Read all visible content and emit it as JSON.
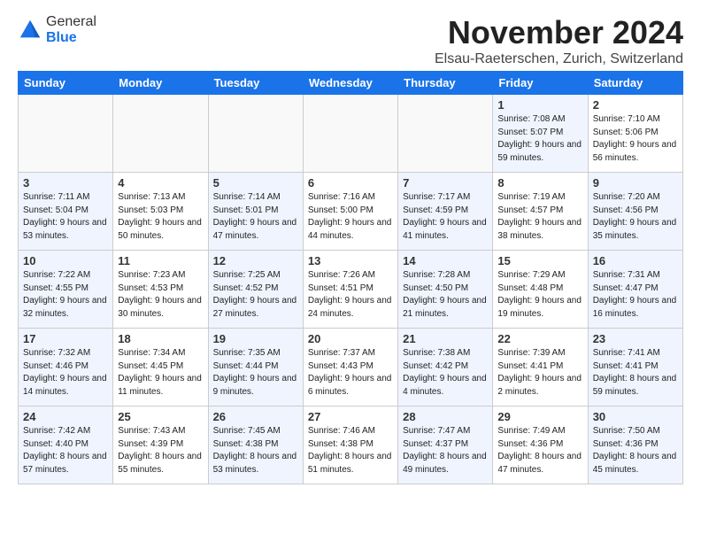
{
  "logo": {
    "general": "General",
    "blue": "Blue"
  },
  "title": "November 2024",
  "subtitle": "Elsau-Raeterschen, Zurich, Switzerland",
  "headers": [
    "Sunday",
    "Monday",
    "Tuesday",
    "Wednesday",
    "Thursday",
    "Friday",
    "Saturday"
  ],
  "weeks": [
    [
      {
        "day": "",
        "info": "",
        "empty": true
      },
      {
        "day": "",
        "info": "",
        "empty": true
      },
      {
        "day": "",
        "info": "",
        "empty": true
      },
      {
        "day": "",
        "info": "",
        "empty": true
      },
      {
        "day": "",
        "info": "",
        "empty": true
      },
      {
        "day": "1",
        "info": "Sunrise: 7:08 AM\nSunset: 5:07 PM\nDaylight: 9 hours and 59 minutes.",
        "shaded": true
      },
      {
        "day": "2",
        "info": "Sunrise: 7:10 AM\nSunset: 5:06 PM\nDaylight: 9 hours and 56 minutes.",
        "shaded": false
      }
    ],
    [
      {
        "day": "3",
        "info": "Sunrise: 7:11 AM\nSunset: 5:04 PM\nDaylight: 9 hours and 53 minutes.",
        "shaded": true
      },
      {
        "day": "4",
        "info": "Sunrise: 7:13 AM\nSunset: 5:03 PM\nDaylight: 9 hours and 50 minutes.",
        "shaded": false
      },
      {
        "day": "5",
        "info": "Sunrise: 7:14 AM\nSunset: 5:01 PM\nDaylight: 9 hours and 47 minutes.",
        "shaded": true
      },
      {
        "day": "6",
        "info": "Sunrise: 7:16 AM\nSunset: 5:00 PM\nDaylight: 9 hours and 44 minutes.",
        "shaded": false
      },
      {
        "day": "7",
        "info": "Sunrise: 7:17 AM\nSunset: 4:59 PM\nDaylight: 9 hours and 41 minutes.",
        "shaded": true
      },
      {
        "day": "8",
        "info": "Sunrise: 7:19 AM\nSunset: 4:57 PM\nDaylight: 9 hours and 38 minutes.",
        "shaded": false
      },
      {
        "day": "9",
        "info": "Sunrise: 7:20 AM\nSunset: 4:56 PM\nDaylight: 9 hours and 35 minutes.",
        "shaded": true
      }
    ],
    [
      {
        "day": "10",
        "info": "Sunrise: 7:22 AM\nSunset: 4:55 PM\nDaylight: 9 hours and 32 minutes.",
        "shaded": true
      },
      {
        "day": "11",
        "info": "Sunrise: 7:23 AM\nSunset: 4:53 PM\nDaylight: 9 hours and 30 minutes.",
        "shaded": false
      },
      {
        "day": "12",
        "info": "Sunrise: 7:25 AM\nSunset: 4:52 PM\nDaylight: 9 hours and 27 minutes.",
        "shaded": true
      },
      {
        "day": "13",
        "info": "Sunrise: 7:26 AM\nSunset: 4:51 PM\nDaylight: 9 hours and 24 minutes.",
        "shaded": false
      },
      {
        "day": "14",
        "info": "Sunrise: 7:28 AM\nSunset: 4:50 PM\nDaylight: 9 hours and 21 minutes.",
        "shaded": true
      },
      {
        "day": "15",
        "info": "Sunrise: 7:29 AM\nSunset: 4:48 PM\nDaylight: 9 hours and 19 minutes.",
        "shaded": false
      },
      {
        "day": "16",
        "info": "Sunrise: 7:31 AM\nSunset: 4:47 PM\nDaylight: 9 hours and 16 minutes.",
        "shaded": true
      }
    ],
    [
      {
        "day": "17",
        "info": "Sunrise: 7:32 AM\nSunset: 4:46 PM\nDaylight: 9 hours and 14 minutes.",
        "shaded": true
      },
      {
        "day": "18",
        "info": "Sunrise: 7:34 AM\nSunset: 4:45 PM\nDaylight: 9 hours and 11 minutes.",
        "shaded": false
      },
      {
        "day": "19",
        "info": "Sunrise: 7:35 AM\nSunset: 4:44 PM\nDaylight: 9 hours and 9 minutes.",
        "shaded": true
      },
      {
        "day": "20",
        "info": "Sunrise: 7:37 AM\nSunset: 4:43 PM\nDaylight: 9 hours and 6 minutes.",
        "shaded": false
      },
      {
        "day": "21",
        "info": "Sunrise: 7:38 AM\nSunset: 4:42 PM\nDaylight: 9 hours and 4 minutes.",
        "shaded": true
      },
      {
        "day": "22",
        "info": "Sunrise: 7:39 AM\nSunset: 4:41 PM\nDaylight: 9 hours and 2 minutes.",
        "shaded": false
      },
      {
        "day": "23",
        "info": "Sunrise: 7:41 AM\nSunset: 4:41 PM\nDaylight: 8 hours and 59 minutes.",
        "shaded": true
      }
    ],
    [
      {
        "day": "24",
        "info": "Sunrise: 7:42 AM\nSunset: 4:40 PM\nDaylight: 8 hours and 57 minutes.",
        "shaded": true
      },
      {
        "day": "25",
        "info": "Sunrise: 7:43 AM\nSunset: 4:39 PM\nDaylight: 8 hours and 55 minutes.",
        "shaded": false
      },
      {
        "day": "26",
        "info": "Sunrise: 7:45 AM\nSunset: 4:38 PM\nDaylight: 8 hours and 53 minutes.",
        "shaded": true
      },
      {
        "day": "27",
        "info": "Sunrise: 7:46 AM\nSunset: 4:38 PM\nDaylight: 8 hours and 51 minutes.",
        "shaded": false
      },
      {
        "day": "28",
        "info": "Sunrise: 7:47 AM\nSunset: 4:37 PM\nDaylight: 8 hours and 49 minutes.",
        "shaded": true
      },
      {
        "day": "29",
        "info": "Sunrise: 7:49 AM\nSunset: 4:36 PM\nDaylight: 8 hours and 47 minutes.",
        "shaded": false
      },
      {
        "day": "30",
        "info": "Sunrise: 7:50 AM\nSunset: 4:36 PM\nDaylight: 8 hours and 45 minutes.",
        "shaded": true
      }
    ]
  ]
}
